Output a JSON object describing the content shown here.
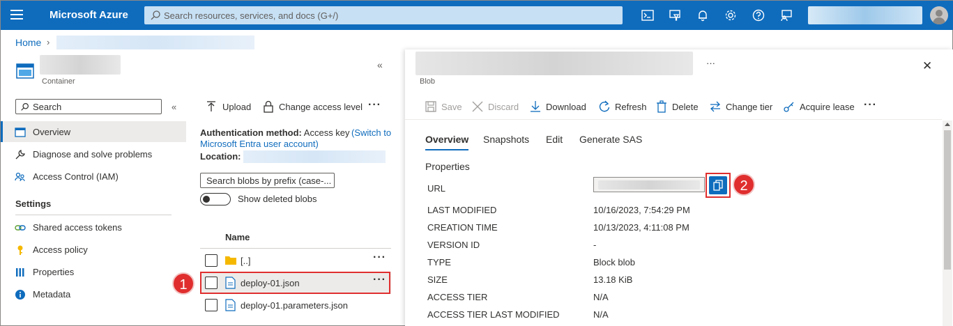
{
  "topbar": {
    "brand": "Microsoft Azure",
    "search_placeholder": "Search resources, services, and docs (G+/)",
    "icons": [
      "cloud-shell-icon",
      "directory-filter-icon",
      "notifications-bell-icon",
      "settings-gear-icon",
      "help-question-icon",
      "feedback-icon"
    ]
  },
  "breadcrumb": {
    "home": "Home",
    "chevron": "›"
  },
  "resource": {
    "type_label": "Container",
    "collapse": "«"
  },
  "sidebar": {
    "search_placeholder": "Search",
    "collapse": "«",
    "items": [
      {
        "label": "Overview",
        "icon": "overview-icon"
      },
      {
        "label": "Diagnose and solve problems",
        "icon": "wrench-icon"
      },
      {
        "label": "Access Control (IAM)",
        "icon": "people-icon"
      }
    ],
    "settings_header": "Settings",
    "settings_items": [
      {
        "label": "Shared access tokens",
        "icon": "link-icon"
      },
      {
        "label": "Access policy",
        "icon": "key-icon"
      },
      {
        "label": "Properties",
        "icon": "properties-icon"
      },
      {
        "label": "Metadata",
        "icon": "info-icon"
      }
    ]
  },
  "container_pane": {
    "toolbar": {
      "upload": "Upload",
      "change_access": "Change access level",
      "more": "···"
    },
    "auth_label": "Authentication method:",
    "auth_value": "Access key",
    "auth_link": "(Switch to Microsoft Entra user account)",
    "location_label": "Location:",
    "search_placeholder": "Search blobs by prefix (case-...",
    "show_deleted": "Show deleted blobs",
    "col_name": "Name",
    "rows": [
      {
        "name": "[..]",
        "icon": "folder-icon"
      },
      {
        "name": "deploy-01.json",
        "icon": "file-icon"
      },
      {
        "name": "deploy-01.parameters.json",
        "icon": "file-icon"
      }
    ],
    "row_more": "···",
    "callout_1": "1"
  },
  "blob_pane": {
    "subtitle": "Blob",
    "header_more": "···",
    "close": "✕",
    "toolbar": {
      "save": "Save",
      "discard": "Discard",
      "download": "Download",
      "refresh": "Refresh",
      "delete": "Delete",
      "change_tier": "Change tier",
      "acquire_lease": "Acquire lease",
      "more": "···"
    },
    "tabs": [
      "Overview",
      "Snapshots",
      "Edit",
      "Generate SAS"
    ],
    "properties_header": "Properties",
    "url_label": "URL",
    "callout_2": "2",
    "properties": [
      {
        "label": "LAST MODIFIED",
        "value": "10/16/2023, 7:54:29 PM"
      },
      {
        "label": "CREATION TIME",
        "value": "10/13/2023, 4:11:08 PM"
      },
      {
        "label": "VERSION ID",
        "value": "-"
      },
      {
        "label": "TYPE",
        "value": "Block blob"
      },
      {
        "label": "SIZE",
        "value": "13.18 KiB"
      },
      {
        "label": "ACCESS TIER",
        "value": "N/A"
      },
      {
        "label": "ACCESS TIER LAST MODIFIED",
        "value": "N/A"
      }
    ]
  },
  "colors": {
    "accent": "#0f6cbd",
    "callout": "#e02e2e",
    "folder": "#f5b800"
  }
}
